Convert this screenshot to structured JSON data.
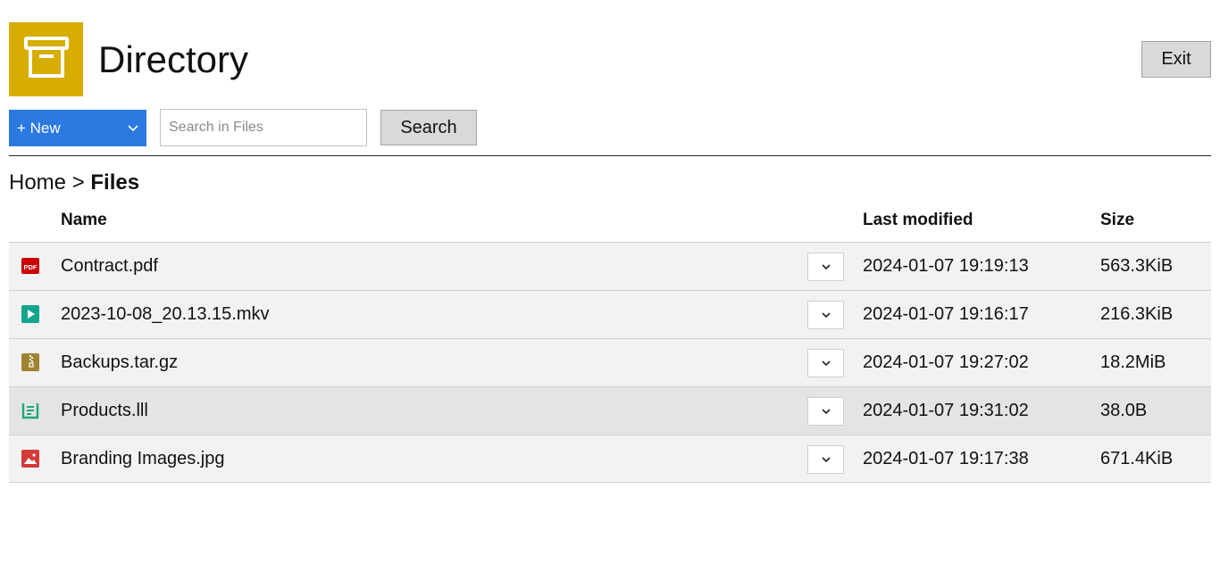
{
  "header": {
    "title": "Directory",
    "logo_icon": "archive-box-icon",
    "exit_label": "Exit",
    "accent_color": "#d6ad00"
  },
  "toolbar": {
    "new_label": "+ New",
    "new_color": "#2a7ae2",
    "search_placeholder": "Search in Files",
    "search_value": "",
    "search_label": "Search"
  },
  "breadcrumb": {
    "home": "Home",
    "separator": ">",
    "current": "Files"
  },
  "table": {
    "columns": {
      "name": "Name",
      "modified": "Last modified",
      "size": "Size"
    },
    "rows": [
      {
        "icon": "pdf-file-icon",
        "icon_color": "#cc0000",
        "name": "Contract.pdf",
        "modified": "2024-01-07 19:19:13",
        "size": "563.3KiB"
      },
      {
        "icon": "video-file-icon",
        "icon_color": "#14a68c",
        "name": "2023-10-08_20.13.15.mkv",
        "modified": "2024-01-07 19:16:17",
        "size": "216.3KiB"
      },
      {
        "icon": "archive-file-icon",
        "icon_color": "#a08434",
        "name": "Backups.tar.gz",
        "modified": "2024-01-07 19:27:02",
        "size": "18.2MiB"
      },
      {
        "icon": "document-file-icon",
        "icon_color": "#1fa87a",
        "name": "Products.lll",
        "modified": "2024-01-07 19:31:02",
        "size": "38.0B"
      },
      {
        "icon": "image-file-icon",
        "icon_color": "#d33a3a",
        "name": "Branding Images.jpg",
        "modified": "2024-01-07 19:17:38",
        "size": "671.4KiB"
      }
    ]
  }
}
